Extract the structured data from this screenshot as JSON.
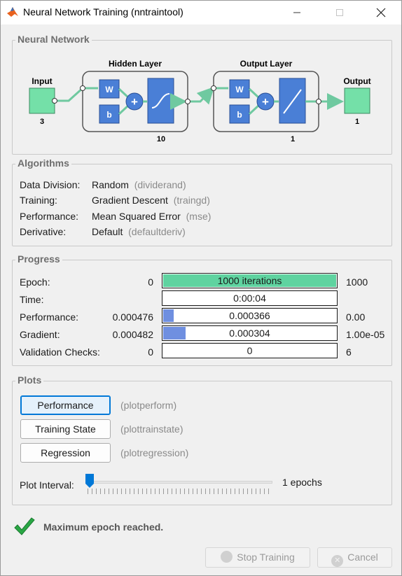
{
  "window": {
    "title": "Neural Network Training (nntraintool)"
  },
  "network": {
    "section_title": "Neural Network",
    "input_label": "Input",
    "input_size": "3",
    "hidden_title": "Hidden Layer",
    "hidden_size": "10",
    "output_title": "Output Layer",
    "output_size": "1",
    "output_label": "Output",
    "output_count": "1",
    "weight_symbol": "W",
    "bias_symbol": "b",
    "sum_symbol": "+"
  },
  "algorithms": {
    "section_title": "Algorithms",
    "rows": [
      {
        "label": "Data Division:",
        "value": "Random",
        "fn": "(dividerand)"
      },
      {
        "label": "Training:",
        "value": "Gradient Descent",
        "fn": "(traingd)"
      },
      {
        "label": "Performance:",
        "value": "Mean Squared Error",
        "fn": "(mse)"
      },
      {
        "label": "Derivative:",
        "value": "Default",
        "fn": "(defaultderiv)"
      }
    ]
  },
  "progress": {
    "section_title": "Progress",
    "rows": [
      {
        "label": "Epoch:",
        "start": "0",
        "current": "1000 iterations",
        "end": "1000",
        "fill": 1.0,
        "color": "#5fd3a0"
      },
      {
        "label": "Time:",
        "start": "",
        "current": "0:00:04",
        "end": "",
        "fill": 0,
        "color": "#6f8fe0"
      },
      {
        "label": "Performance:",
        "start": "0.000476",
        "current": "0.000366",
        "end": "0.00",
        "fill": 0.06,
        "color": "#6f8fe0"
      },
      {
        "label": "Gradient:",
        "start": "0.000482",
        "current": "0.000304",
        "end": "1.00e-05",
        "fill": 0.13,
        "color": "#6f8fe0"
      },
      {
        "label": "Validation Checks:",
        "start": "0",
        "current": "0",
        "end": "6",
        "fill": 0,
        "color": "#6f8fe0"
      }
    ]
  },
  "plots": {
    "section_title": "Plots",
    "buttons": [
      {
        "label": "Performance",
        "fn": "(plotperform)"
      },
      {
        "label": "Training State",
        "fn": "(plottrainstate)"
      },
      {
        "label": "Regression",
        "fn": "(plotregression)"
      }
    ],
    "interval_label": "Plot Interval:",
    "interval_value": "1 epochs",
    "interval_level": 0
  },
  "status": {
    "message": "Maximum epoch reached."
  },
  "footer": {
    "stop_label": "Stop Training",
    "cancel_label": "Cancel"
  },
  "colors": {
    "layer_blue": "#4a7fd6",
    "io_green": "#74e0a8",
    "check_green": "#2aa745"
  }
}
